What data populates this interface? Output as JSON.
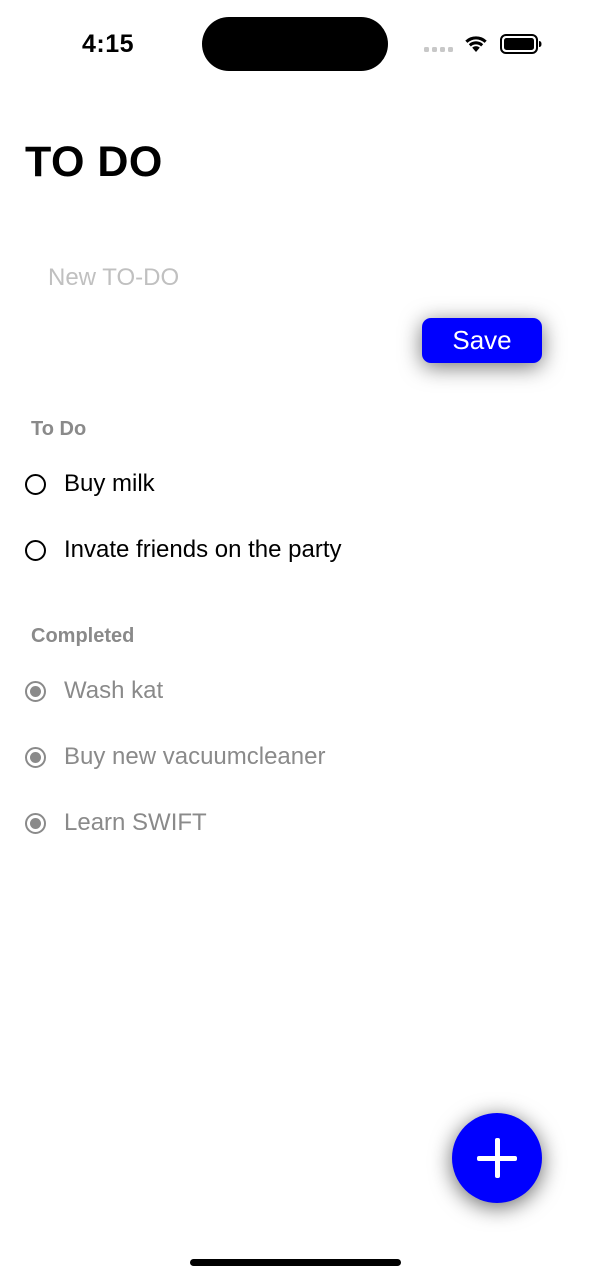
{
  "status_bar": {
    "time": "4:15",
    "icons": [
      "signal-icon",
      "wifi-icon",
      "battery-icon"
    ]
  },
  "header": {
    "title": "TO DO"
  },
  "new_todo": {
    "placeholder": "New TO-DO",
    "value": "",
    "save_label": "Save"
  },
  "todo_section": {
    "title": "To Do",
    "items": [
      {
        "label": "Buy milk",
        "completed": false
      },
      {
        "label": "Invate friends on the party",
        "completed": false
      }
    ]
  },
  "completed_section": {
    "title": "Completed",
    "items": [
      {
        "label": "Wash kat",
        "completed": true
      },
      {
        "label": "Buy new vacuumcleaner",
        "completed": true
      },
      {
        "label": "Learn SWIFT",
        "completed": true
      }
    ]
  },
  "fab": {
    "icon": "plus-icon"
  },
  "colors": {
    "accent": "#0000ff",
    "muted": "#8a8a8a",
    "placeholder": "#c0c0c0",
    "text": "#000000",
    "background": "#ffffff"
  }
}
